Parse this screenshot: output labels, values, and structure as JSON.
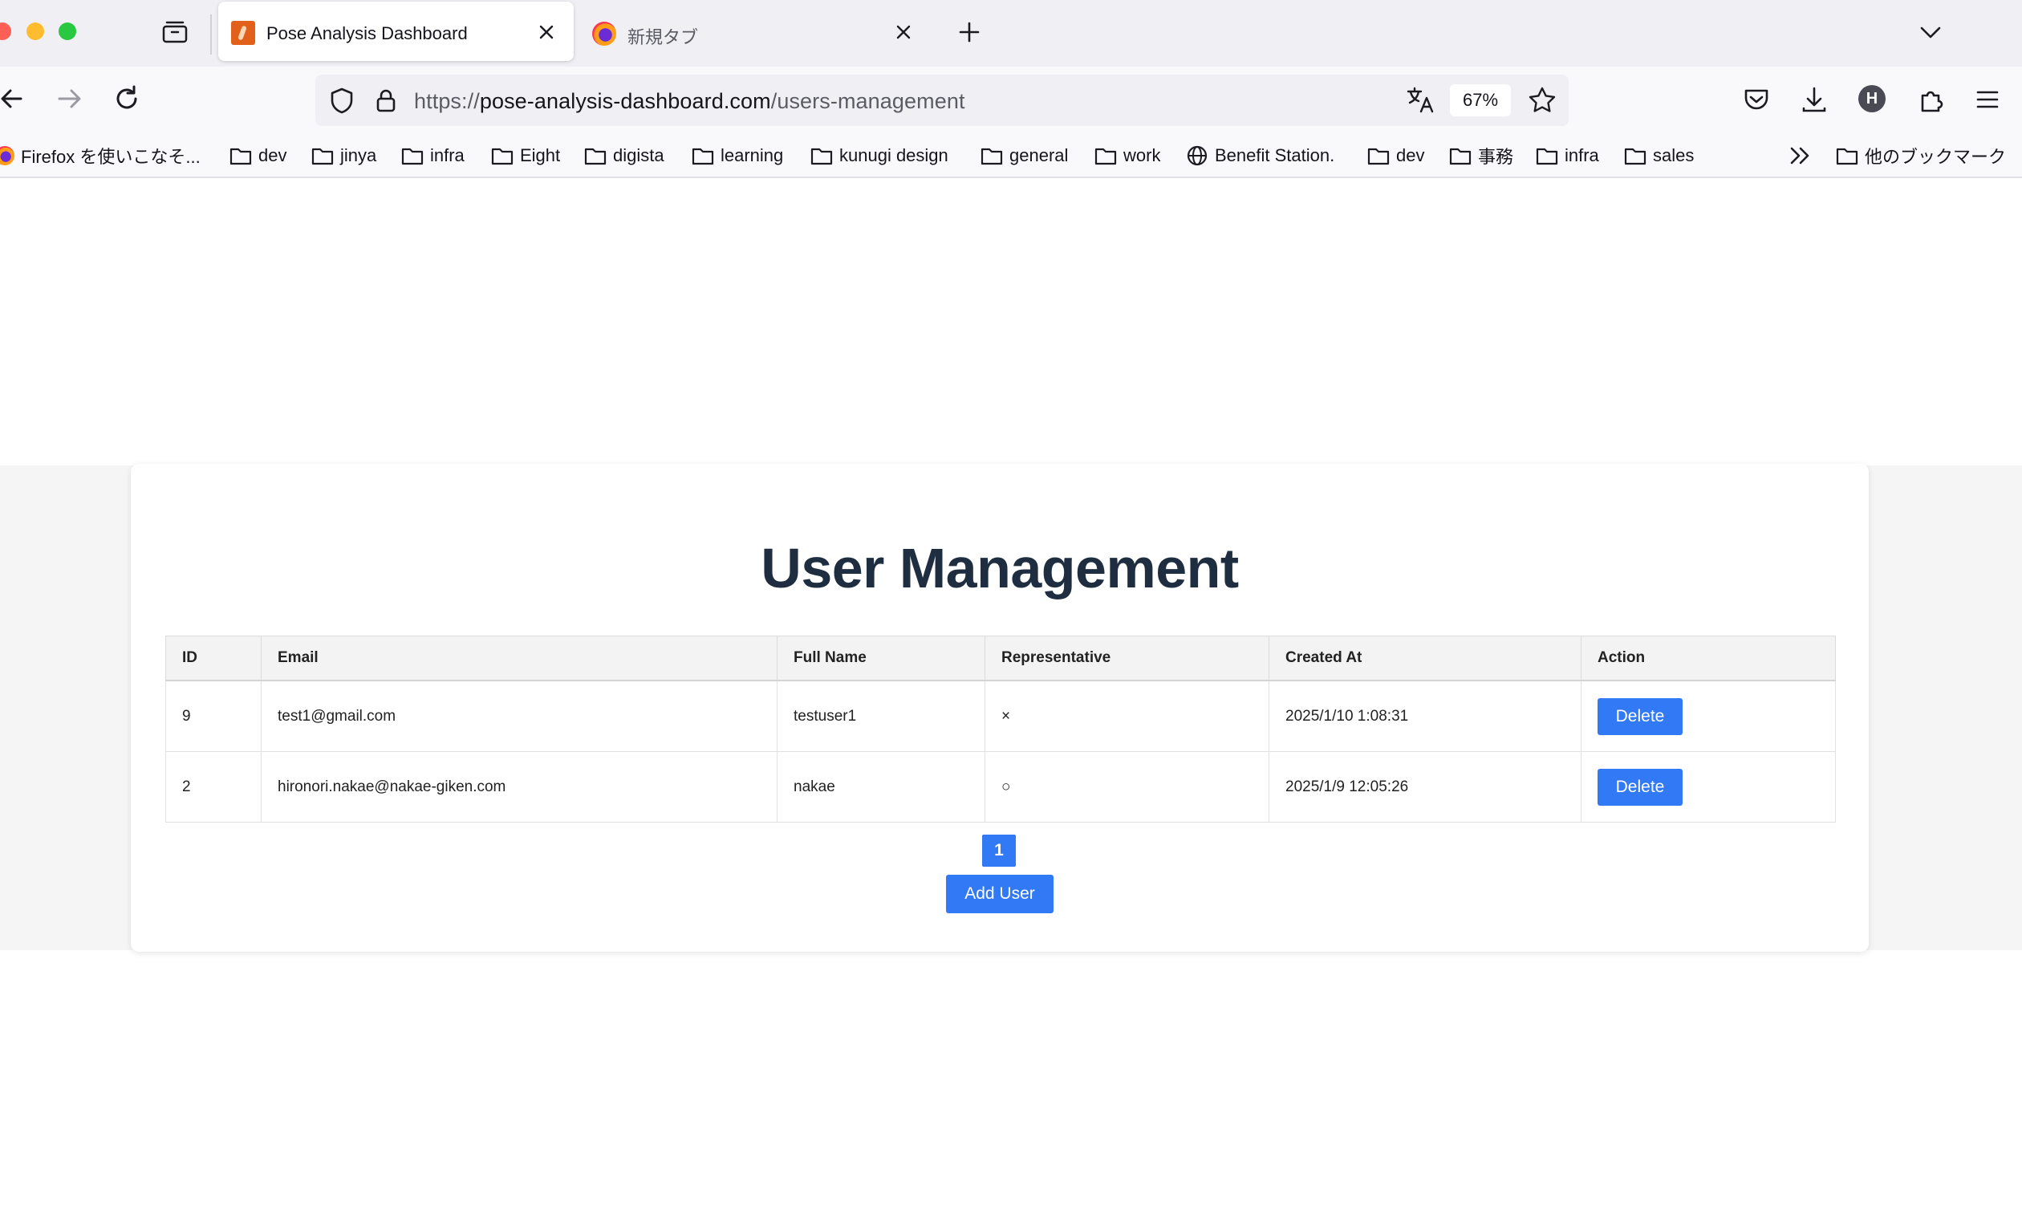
{
  "browser": {
    "tabs": [
      {
        "title": "Pose Analysis Dashboard",
        "active": true
      },
      {
        "title": "新規タブ",
        "active": false
      }
    ],
    "url": {
      "scheme": "https://",
      "host": "pose-analysis-dashboard.com",
      "path": "/users-management"
    },
    "zoom": "67%",
    "profile_initial": "H",
    "bookmarks": [
      {
        "label": "Firefox を使いこなそ...",
        "icon": "firefox-icon"
      },
      {
        "label": "dev",
        "icon": "folder-icon"
      },
      {
        "label": "jinya",
        "icon": "folder-icon"
      },
      {
        "label": "infra",
        "icon": "folder-icon"
      },
      {
        "label": "Eight",
        "icon": "folder-icon"
      },
      {
        "label": "digista",
        "icon": "folder-icon"
      },
      {
        "label": "learning",
        "icon": "folder-icon"
      },
      {
        "label": "kunugi design",
        "icon": "folder-icon"
      },
      {
        "label": "general",
        "icon": "folder-icon"
      },
      {
        "label": "work",
        "icon": "folder-icon"
      },
      {
        "label": "Benefit Station.",
        "icon": "globe-icon"
      },
      {
        "label": "dev",
        "icon": "folder-icon"
      },
      {
        "label": "事務",
        "icon": "folder-icon"
      },
      {
        "label": "infra",
        "icon": "folder-icon"
      },
      {
        "label": "sales",
        "icon": "folder-icon"
      }
    ],
    "other_bookmarks": "他のブックマーク"
  },
  "page": {
    "title": "User Management",
    "table": {
      "headers": [
        "ID",
        "Email",
        "Full Name",
        "Representative",
        "Created At",
        "Action"
      ],
      "rows": [
        {
          "id": "9",
          "email": "test1@gmail.com",
          "full_name": "testuser1",
          "representative": "×",
          "created_at": "2025/1/10 1:08:31",
          "action": "Delete"
        },
        {
          "id": "2",
          "email": "hironori.nakae@nakae-giken.com",
          "full_name": "nakae",
          "representative": "○",
          "created_at": "2025/1/9 12:05:26",
          "action": "Delete"
        }
      ]
    },
    "pagination": {
      "current": "1"
    },
    "add_user_label": "Add User"
  },
  "colors": {
    "primary_button": "#3279f5",
    "title_text": "#1e2d40",
    "page_band": "#f5f5f5"
  }
}
